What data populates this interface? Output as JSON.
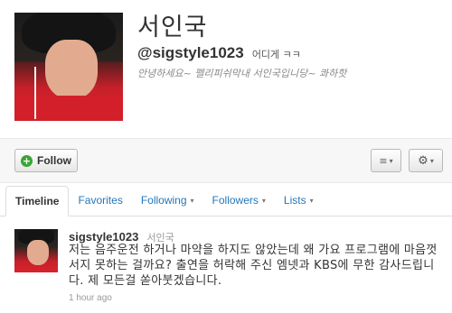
{
  "profile": {
    "name": "서인국",
    "handle": "@sigstyle1023",
    "location": "어디게 ㅋㅋ",
    "bio": "안녕하세요~ 펠리피쉬막내 서인국입니당~ 콰하핫"
  },
  "actions": {
    "follow_label": "Follow",
    "follow_icon": "+",
    "list_icon": "≡",
    "gear_icon": "⚙",
    "caret": "▾"
  },
  "tabs": [
    {
      "label": "Timeline"
    },
    {
      "label": "Favorites"
    },
    {
      "label": "Following"
    },
    {
      "label": "Followers"
    },
    {
      "label": "Lists"
    }
  ],
  "tweet": {
    "username": "sigstyle1023",
    "fullname": "서인국",
    "text": "저는 음주운전 하거나 마약을 하지도 않았는데 왜 가요 프로그램에 마음껏 서지 못하는 걸까요? 출연을 허락해 주신 엠넷과 KBS에 무한 감사드립니다. 제 모든걸 쏟아붓겠습니다.",
    "time": "1 hour ago"
  },
  "colors": {
    "link": "#2276bb",
    "follow_green": "#3aa535"
  }
}
